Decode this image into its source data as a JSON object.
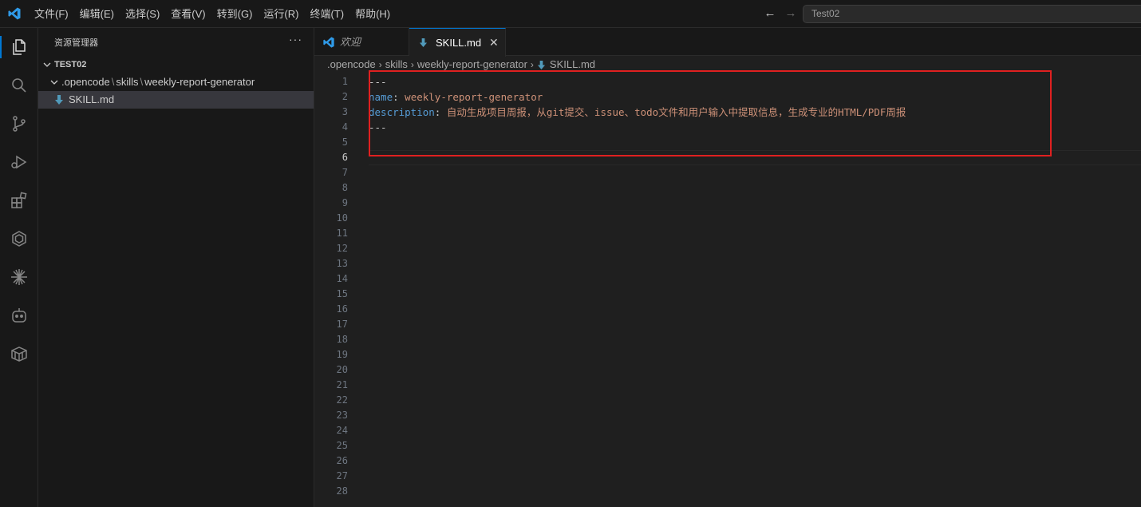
{
  "menu": [
    "文件(F)",
    "编辑(E)",
    "选择(S)",
    "查看(V)",
    "转到(G)",
    "运行(R)",
    "终端(T)",
    "帮助(H)"
  ],
  "command_center": "Test02",
  "activity_icons": [
    "explorer-icon",
    "search-icon",
    "source-control-icon",
    "run-debug-icon",
    "extensions-icon",
    "remote-icon",
    "sparkle-icon",
    "copilot-icon",
    "package-icon"
  ],
  "sidebar": {
    "title": "资源管理器",
    "more": "···",
    "root": "TEST02",
    "folder": {
      "parts": [
        ".opencode",
        "skills",
        "weekly-report-generator"
      ]
    },
    "file": "SKILL.md"
  },
  "tabs": {
    "welcome": "欢迎",
    "active": "SKILL.md",
    "close": "✕"
  },
  "breadcrumb": [
    ".opencode",
    "skills",
    "weekly-report-generator",
    "SKILL.md"
  ],
  "editor": {
    "line_numbers": [
      "1",
      "2",
      "3",
      "4",
      "5",
      "6",
      "7",
      "8",
      "9",
      "10",
      "11",
      "12",
      "13",
      "14",
      "15",
      "16",
      "17",
      "18",
      "19",
      "20",
      "21",
      "22",
      "23",
      "24",
      "25",
      "26",
      "27",
      "28"
    ],
    "active_line": "6",
    "lines": {
      "l1": "---",
      "l2_key": "name",
      "l2_colon": ": ",
      "l2_val": "weekly-report-generator",
      "l3_key": "description",
      "l3_colon": ": ",
      "l3_val": "自动生成项目周报，从git提交、issue、todo文件和用户输入中提取信息，生成专业的HTML/PDF周报",
      "l4": "---"
    }
  },
  "colors": {
    "accent": "#0078d4",
    "highlight_box": "#e02020",
    "yaml_key": "#569cd6",
    "yaml_value": "#ce9178"
  }
}
